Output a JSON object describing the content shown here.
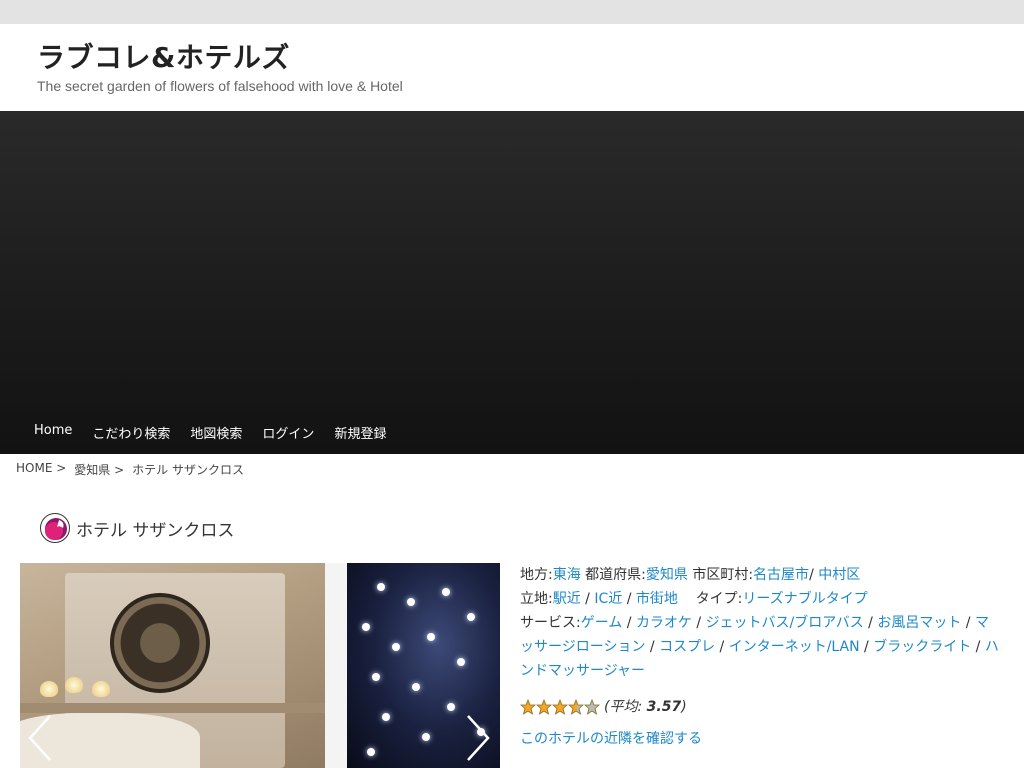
{
  "site": {
    "title": "ラブコレ&ホテルズ",
    "tagline": "The secret garden of flowers of falsehood with love & Hotel"
  },
  "nav": [
    "Home",
    "こだわり検索",
    "地図検索",
    "ログイン",
    "新規登録"
  ],
  "breadcrumb": [
    "HOME >",
    "愛知県 >",
    "ホテル サザンクロス"
  ],
  "hotel": {
    "name": "ホテル サザンクロス",
    "region_label": "地方:",
    "region": "東海",
    "pref_label": "都道府県:",
    "prefecture": "愛知県",
    "city_label": "市区町村:",
    "city": "名古屋市",
    "ward": "中村区",
    "location_label": "立地:",
    "locations": [
      "駅近",
      "IC近",
      "市街地"
    ],
    "type_label": "タイプ:",
    "type": "リーズナブルタイプ",
    "service_label": "サービス:",
    "services": [
      "ゲーム",
      "カラオケ",
      "ジェットバス/ブロアバス",
      "お風呂マット",
      "マッサージローション",
      "コスプレ",
      "インターネット/LAN",
      "ブラックライト",
      "ハンドマッサージャー"
    ],
    "rating": 3.57,
    "rating_max": 5,
    "rating_prefix": "(",
    "rating_label": "平均:",
    "rating_value": "3.57",
    "rating_suffix": ")",
    "nearby_link": "このホテルの近隣を確認する"
  },
  "colors": {
    "link": "#1e88c8",
    "hero": "#1c1c1c",
    "star": "#f5a623"
  },
  "icons": {
    "prev": "chevron-left-icon",
    "next": "chevron-right-icon",
    "logo": "brand-logo-icon"
  }
}
